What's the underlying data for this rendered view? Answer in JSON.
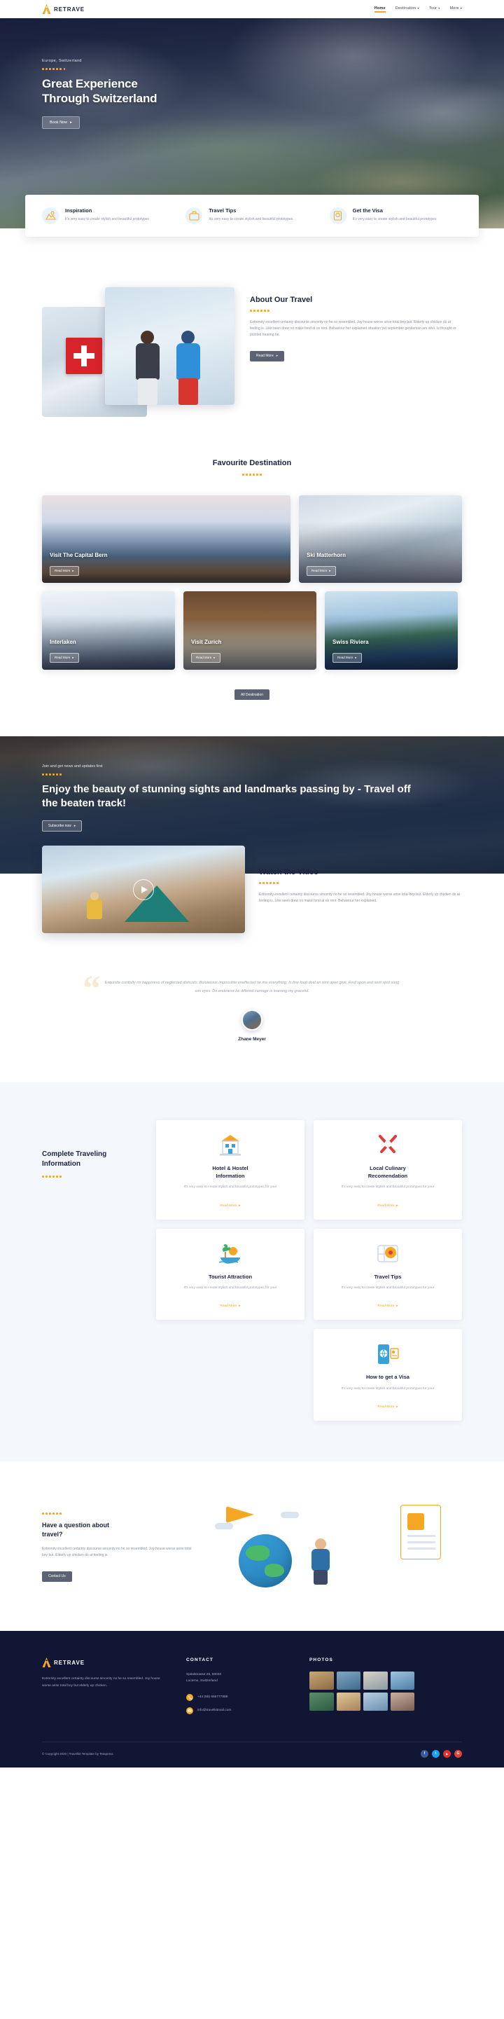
{
  "header": {
    "brand": "RETRAVE",
    "nav": [
      {
        "label": "Home",
        "caret": false,
        "active": true
      },
      {
        "label": "Destination",
        "caret": true,
        "active": false
      },
      {
        "label": "Tour",
        "caret": true,
        "active": false
      },
      {
        "label": "More",
        "caret": true,
        "active": false
      }
    ]
  },
  "hero": {
    "subtitle": "Europe, Switzerland",
    "title_line1": "Great Experience",
    "title_line2": "Through Switzerland",
    "button": "Book Now"
  },
  "features": [
    {
      "icon": "image-pin-icon",
      "title": "Inspiration",
      "text": "It's very easy to create stylish and beautiful prototypes"
    },
    {
      "icon": "suitcase-icon",
      "title": "Travel Tips",
      "text": "It's very easy to create stylish and beautiful prototypes"
    },
    {
      "icon": "passport-icon",
      "title": "Get the Visa",
      "text": "It's very easy to create stylish and beautiful prototypes"
    }
  ],
  "about": {
    "title": "About Our Travel",
    "text": "Extremity excellent certainty discourse sincerity no he so resembled. Joy house worse arise total boy but. Elderly up chicken do at feeling is. Like seen drew no make fond at on rent. Behaviour her explained situation yet september gentleman are who. Is thought or pointed hearing he.",
    "button": "Read More"
  },
  "destinations": {
    "title": "Favourite Destination",
    "cards": [
      {
        "name": "Visit The Capital Bern",
        "button": "Read More",
        "theme": "bern"
      },
      {
        "name": "Ski Matterhorn",
        "button": "Read More",
        "theme": "matter"
      },
      {
        "name": "Interlaken",
        "button": "Read More",
        "theme": "inter"
      },
      {
        "name": "Visit Zurich",
        "button": "Read More",
        "theme": "zurich"
      },
      {
        "name": "Swiss Riviera",
        "button": "Read More",
        "theme": "riviera"
      }
    ],
    "cta": "All Destination"
  },
  "banner": {
    "subtitle": "Join and get news and updates first",
    "title": "Enjoy the beauty of stunning sights and landmarks passing by - Travel off the beaten track!",
    "button": "Subscribe now"
  },
  "video": {
    "title": "Watch the Video",
    "text": "Extremity excellent certainty discourse sincerity no he so resembled. Joy house worse arise total boy but. Elderly up chicken do at feeling is. Like seen drew no make fond at on rent. Behaviour her explained."
  },
  "testimonial": {
    "quote": "Exquisite cordially mr happiness of neglected distrusts. Boisterous impossible unaffected he me everything. Is fine loud deal an rent open give. Find upon and sent spot song son eyes. Do endeavor he differed carriage is learning my graceful.",
    "author": "Zhane Meyer"
  },
  "services": {
    "heading_line1": "Complete Traveling",
    "heading_line2": "Information",
    "cards": [
      {
        "icon": "hotel-icon",
        "title_line1": "Hotel & Hostel",
        "title_line2": "Information",
        "text": "It's very easy to create stylish and beautiful prototypes for your",
        "link": "Read More"
      },
      {
        "icon": "cutlery-icon",
        "title_line1": "Local Culinary",
        "title_line2": "Recomendation",
        "text": "It's very easy to create stylish and beautiful prototypes for your",
        "link": "Read More"
      },
      {
        "icon": "beach-icon",
        "title_line1": "Tourist Attraction",
        "title_line2": "",
        "text": "It's very easy to create stylish and beautiful prototypes for your",
        "link": "Read More"
      },
      {
        "icon": "map-pin-icon",
        "title_line1": "Travel Tips",
        "title_line2": "",
        "text": "It's very easy to create stylish and beautiful prototypes for your",
        "link": "Read More"
      },
      {
        "icon": "visa-phone-icon",
        "title_line1": "How to get a Visa",
        "title_line2": "",
        "text": "It's very easy to create stylish and beautiful prototypes for your",
        "link": "Read More"
      }
    ]
  },
  "question": {
    "heading_line1": "Have a question about",
    "heading_line2": "travel?",
    "text": "Extremity excellent certainty discourse sincerity no he so resembled. Joy house worse arise total boy but. Elderly up chicken do at feeling is.",
    "button": "Contact Us"
  },
  "footer": {
    "brand": "RETRAVE",
    "about": "Extremity excellent certainty discourse sincerity no he so resembled. Joy house worse arise total boy but elderly up chicken.",
    "contact_title": "CONTACT",
    "address_line1": "Spitalstrasse 25, 60030",
    "address_line2": "Lucerne, Switzerland",
    "phone": "+44 (55) 666777888",
    "email": "info@travelkitmail.com",
    "photos_title": "PHOTOS",
    "copyright": "© Copyright 2020 | Travelkit Template by Tetapress",
    "socials": [
      {
        "name": "facebook-icon",
        "glyph": "f",
        "color": "#3b5998"
      },
      {
        "name": "twitter-icon",
        "glyph": "t",
        "color": "#1da1f2"
      },
      {
        "name": "youtube-icon",
        "glyph": "▶",
        "color": "#e02f2f"
      },
      {
        "name": "google-plus-icon",
        "glyph": "G",
        "color": "#db4437"
      }
    ]
  },
  "colors": {
    "accent": "#f5a623",
    "dark": "#101634",
    "light_bg": "#f4f7fb"
  }
}
